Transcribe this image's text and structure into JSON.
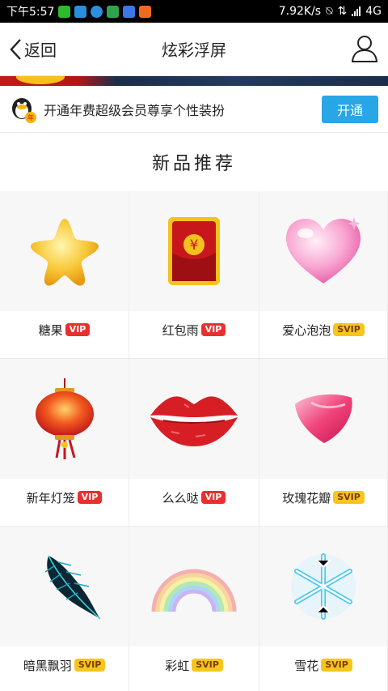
{
  "status_bar": {
    "time": "下午5:57",
    "speed": "7.92K/s",
    "network": "4G"
  },
  "nav": {
    "back_label": "返回",
    "title": "炫彩浮屏"
  },
  "vip_banner": {
    "text": "开通年费超级会员尊享个性装扮",
    "button": "开通"
  },
  "section_title": "新品推荐",
  "items": [
    {
      "name": "糖果",
      "badge": "VIP",
      "icon": "star-candy-icon"
    },
    {
      "name": "红包雨",
      "badge": "VIP",
      "icon": "red-envelope-icon"
    },
    {
      "name": "爱心泡泡",
      "badge": "SVIP",
      "icon": "heart-bubble-icon"
    },
    {
      "name": "新年灯笼",
      "badge": "VIP",
      "icon": "lantern-icon"
    },
    {
      "name": "么么哒",
      "badge": "VIP",
      "icon": "lips-icon"
    },
    {
      "name": "玫瑰花瓣",
      "badge": "SVIP",
      "icon": "rose-petal-icon"
    },
    {
      "name": "暗黑飘羽",
      "badge": "SVIP",
      "icon": "feather-icon"
    },
    {
      "name": "彩虹",
      "badge": "SVIP",
      "icon": "rainbow-icon"
    },
    {
      "name": "雪花",
      "badge": "SVIP",
      "icon": "snowflake-icon"
    }
  ],
  "colors": {
    "vip": "#e8302d",
    "svip": "#f7c51b",
    "accent": "#28a6e6"
  }
}
